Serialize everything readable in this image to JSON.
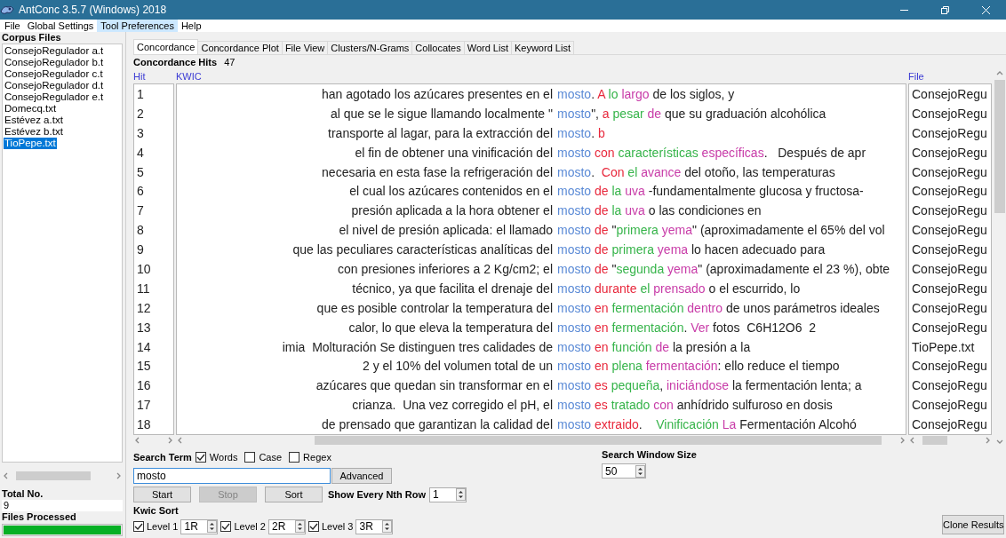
{
  "window": {
    "title": "AntConc 3.5.7 (Windows) 2018"
  },
  "menu": [
    {
      "label": "File",
      "selected": false
    },
    {
      "label": "Global Settings",
      "selected": false
    },
    {
      "label": "Tool Preferences",
      "selected": true
    },
    {
      "label": "Help",
      "selected": false
    }
  ],
  "corpus_files": {
    "title": "Corpus Files",
    "files": [
      {
        "name": "ConsejoRegulador a.t",
        "selected": false
      },
      {
        "name": "ConsejoRegulador b.t",
        "selected": false
      },
      {
        "name": "ConsejoRegulador c.t",
        "selected": false
      },
      {
        "name": "ConsejoRegulador d.t",
        "selected": false
      },
      {
        "name": "ConsejoRegulador e.t",
        "selected": false
      },
      {
        "name": "Domecq.txt",
        "selected": false
      },
      {
        "name": "Estévez a.txt",
        "selected": false
      },
      {
        "name": "Estévez b.txt",
        "selected": false
      },
      {
        "name": "TioPepe.txt",
        "selected": true
      }
    ]
  },
  "total": {
    "label": "Total No.",
    "value": "9"
  },
  "files_processed": {
    "label": "Files Processed",
    "level": 1
  },
  "tabs": [
    {
      "label": "Concordance",
      "selected": true
    },
    {
      "label": "Concordance Plot",
      "selected": false
    },
    {
      "label": "File View",
      "selected": false
    },
    {
      "label": "Clusters/N-Grams",
      "selected": false
    },
    {
      "label": "Collocates",
      "selected": false
    },
    {
      "label": "Word List",
      "selected": false
    },
    {
      "label": "Keyword List",
      "selected": false
    }
  ],
  "hits": {
    "label": "Concordance Hits",
    "count": "47"
  },
  "table": {
    "columns": [
      "Hit",
      "KWIC",
      "File"
    ],
    "rows": [
      {
        "hit": "1",
        "left": "han agotado los azúcares presentes en el",
        "keyword": "mosto",
        "right": [
          {
            "text": "."
          },
          {
            "text": " A",
            "color": "#e8283c"
          },
          {
            "text": " lo",
            "color": "#36b44a"
          },
          {
            "text": " largo",
            "color": "#c83ca8"
          },
          {
            "text": " de los siglos, y"
          }
        ],
        "file": "ConsejoRegu"
      },
      {
        "hit": "2",
        "left": "al que se le sigue llamando localmente \"",
        "keyword": "mosto",
        "right": [
          {
            "text": "\","
          },
          {
            "text": " a",
            "color": "#e8283c"
          },
          {
            "text": " pesar",
            "color": "#36b44a"
          },
          {
            "text": " de",
            "color": "#c83ca8"
          },
          {
            "text": " que su graduación alcohólica"
          }
        ],
        "file": "ConsejoRegu"
      },
      {
        "hit": "3",
        "left": "transporte al lagar, para la extracción del",
        "keyword": "mosto",
        "right": [
          {
            "text": "."
          },
          {
            "text": " b",
            "color": "#e8283c"
          }
        ],
        "file": "ConsejoRegu"
      },
      {
        "hit": "4",
        "left": "el fin de obtener una vinificación del",
        "keyword": "mosto",
        "right": [
          {
            "text": " con",
            "color": "#e8283c"
          },
          {
            "text": " características",
            "color": "#36b44a"
          },
          {
            "text": " específicas",
            "color": "#c83ca8"
          },
          {
            "text": ".   Después de apr"
          }
        ],
        "file": "ConsejoRegu"
      },
      {
        "hit": "5",
        "left": "necesaria en esta fase la refrigeración del",
        "keyword": "mosto",
        "right": [
          {
            "text": "."
          },
          {
            "text": "  Con",
            "color": "#e8283c"
          },
          {
            "text": " el",
            "color": "#36b44a"
          },
          {
            "text": " avance",
            "color": "#c83ca8"
          },
          {
            "text": " del otoño, las temperaturas"
          }
        ],
        "file": "ConsejoRegu"
      },
      {
        "hit": "6",
        "left": "el cual los azúcares contenidos en el",
        "keyword": "mosto",
        "right": [
          {
            "text": " de",
            "color": "#e8283c"
          },
          {
            "text": " la",
            "color": "#36b44a"
          },
          {
            "text": " uva",
            "color": "#c83ca8"
          },
          {
            "text": " -fundamentalmente glucosa y fructosa-"
          }
        ],
        "file": "ConsejoRegu"
      },
      {
        "hit": "7",
        "left": "presión aplicada a la hora obtener el",
        "keyword": "mosto",
        "right": [
          {
            "text": " de",
            "color": "#e8283c"
          },
          {
            "text": " la",
            "color": "#36b44a"
          },
          {
            "text": " uva",
            "color": "#c83ca8"
          },
          {
            "text": " o las condiciones en"
          }
        ],
        "file": "ConsejoRegu"
      },
      {
        "hit": "8",
        "left": "el nivel de presión aplicada: el llamado",
        "keyword": "mosto",
        "right": [
          {
            "text": " de",
            "color": "#e8283c"
          },
          {
            "text": " \""
          },
          {
            "text": "primera",
            "color": "#36b44a"
          },
          {
            "text": " yema",
            "color": "#c83ca8"
          },
          {
            "text": "\" (aproximadamente el 65% del vol"
          }
        ],
        "file": "ConsejoRegu"
      },
      {
        "hit": "9",
        "left": "que las peculiares características analíticas del",
        "keyword": "mosto",
        "right": [
          {
            "text": " de",
            "color": "#e8283c"
          },
          {
            "text": " primera",
            "color": "#36b44a"
          },
          {
            "text": " yema",
            "color": "#c83ca8"
          },
          {
            "text": " lo hacen adecuado para"
          }
        ],
        "file": "ConsejoRegu"
      },
      {
        "hit": "10",
        "left": "con presiones inferiores a 2 Kg/cm2; el",
        "keyword": "mosto",
        "right": [
          {
            "text": " de",
            "color": "#e8283c"
          },
          {
            "text": " \""
          },
          {
            "text": "segunda",
            "color": "#36b44a"
          },
          {
            "text": " yema",
            "color": "#c83ca8"
          },
          {
            "text": "\" (aproximadamente el 23 %), obte"
          }
        ],
        "file": "ConsejoRegu"
      },
      {
        "hit": "11",
        "left": "técnico, ya que facilita el drenaje del",
        "keyword": "mosto",
        "right": [
          {
            "text": " durante",
            "color": "#e8283c"
          },
          {
            "text": " el",
            "color": "#36b44a"
          },
          {
            "text": " prensado",
            "color": "#c83ca8"
          },
          {
            "text": " o el escurrido, lo"
          }
        ],
        "file": "ConsejoRegu"
      },
      {
        "hit": "12",
        "left": "que es posible controlar la temperatura del",
        "keyword": "mosto",
        "right": [
          {
            "text": " en",
            "color": "#e8283c"
          },
          {
            "text": " fermentación",
            "color": "#36b44a"
          },
          {
            "text": " dentro",
            "color": "#c83ca8"
          },
          {
            "text": " de unos parámetros ideales"
          }
        ],
        "file": "ConsejoRegu"
      },
      {
        "hit": "13",
        "left": "calor, lo que eleva la temperatura del",
        "keyword": "mosto",
        "right": [
          {
            "text": " en",
            "color": "#e8283c"
          },
          {
            "text": " fermentación",
            "color": "#36b44a"
          },
          {
            "text": "."
          },
          {
            "text": " Ver",
            "color": "#c83ca8"
          },
          {
            "text": " fotos  C6H12O6  2"
          }
        ],
        "file": "ConsejoRegu"
      },
      {
        "hit": "14",
        "left": "imia  Molturación Se distinguen tres calidades de",
        "keyword": "mosto",
        "right": [
          {
            "text": " en",
            "color": "#e8283c"
          },
          {
            "text": " función",
            "color": "#36b44a"
          },
          {
            "text": " de",
            "color": "#c83ca8"
          },
          {
            "text": " la presión a la"
          }
        ],
        "file": "TioPepe.txt"
      },
      {
        "hit": "15",
        "left": "2 y el 10% del volumen total de un",
        "keyword": "mosto",
        "right": [
          {
            "text": " en",
            "color": "#e8283c"
          },
          {
            "text": " plena",
            "color": "#36b44a"
          },
          {
            "text": " fermentación",
            "color": "#c83ca8"
          },
          {
            "text": ": ello reduce el tiempo"
          }
        ],
        "file": "ConsejoRegu"
      },
      {
        "hit": "16",
        "left": "azúcares que quedan sin transformar en el",
        "keyword": "mosto",
        "right": [
          {
            "text": " es",
            "color": "#e8283c"
          },
          {
            "text": " pequeña",
            "color": "#36b44a"
          },
          {
            "text": ","
          },
          {
            "text": " iniciándose",
            "color": "#c83ca8"
          },
          {
            "text": " la fermentación lenta; a"
          }
        ],
        "file": "ConsejoRegu"
      },
      {
        "hit": "17",
        "left": "crianza.  Una vez corregido el pH, el",
        "keyword": "mosto",
        "right": [
          {
            "text": " es",
            "color": "#e8283c"
          },
          {
            "text": " tratado",
            "color": "#36b44a"
          },
          {
            "text": " con",
            "color": "#c83ca8"
          },
          {
            "text": " anhídrido sulfuroso en dosis"
          }
        ],
        "file": "ConsejoRegu"
      },
      {
        "hit": "18",
        "left": "de prensado que garantizan la calidad del",
        "keyword": "mosto",
        "right": [
          {
            "text": " extraido",
            "color": "#e8283c"
          },
          {
            "text": ".    "
          },
          {
            "text": "Vinificación",
            "color": "#36b44a"
          },
          {
            "text": " La",
            "color": "#c83ca8"
          },
          {
            "text": " Fermentación Alcohó"
          }
        ],
        "file": "ConsejoRegu"
      }
    ]
  },
  "search": {
    "label": "Search Term",
    "options": [
      {
        "label": "Words",
        "checked": true
      },
      {
        "label": "Case",
        "checked": false
      },
      {
        "label": "Regex",
        "checked": false
      }
    ],
    "value": "mosto",
    "advanced": "Advanced"
  },
  "window_size": {
    "label": "Search Window Size",
    "value": "50"
  },
  "buttons": [
    {
      "label": "Start",
      "disabled": false
    },
    {
      "label": "Stop",
      "disabled": true
    },
    {
      "label": "Sort",
      "disabled": false
    }
  ],
  "nth_row": {
    "label": "Show Every Nth Row",
    "value": "1"
  },
  "kwic_sort": {
    "label": "Kwic Sort",
    "levels": [
      {
        "label": "Level 1",
        "checked": true,
        "value": "1R"
      },
      {
        "label": "Level 2",
        "checked": true,
        "value": "2R"
      },
      {
        "label": "Level 3",
        "checked": true,
        "value": "3R"
      }
    ]
  },
  "clone_button": "Clone Results"
}
